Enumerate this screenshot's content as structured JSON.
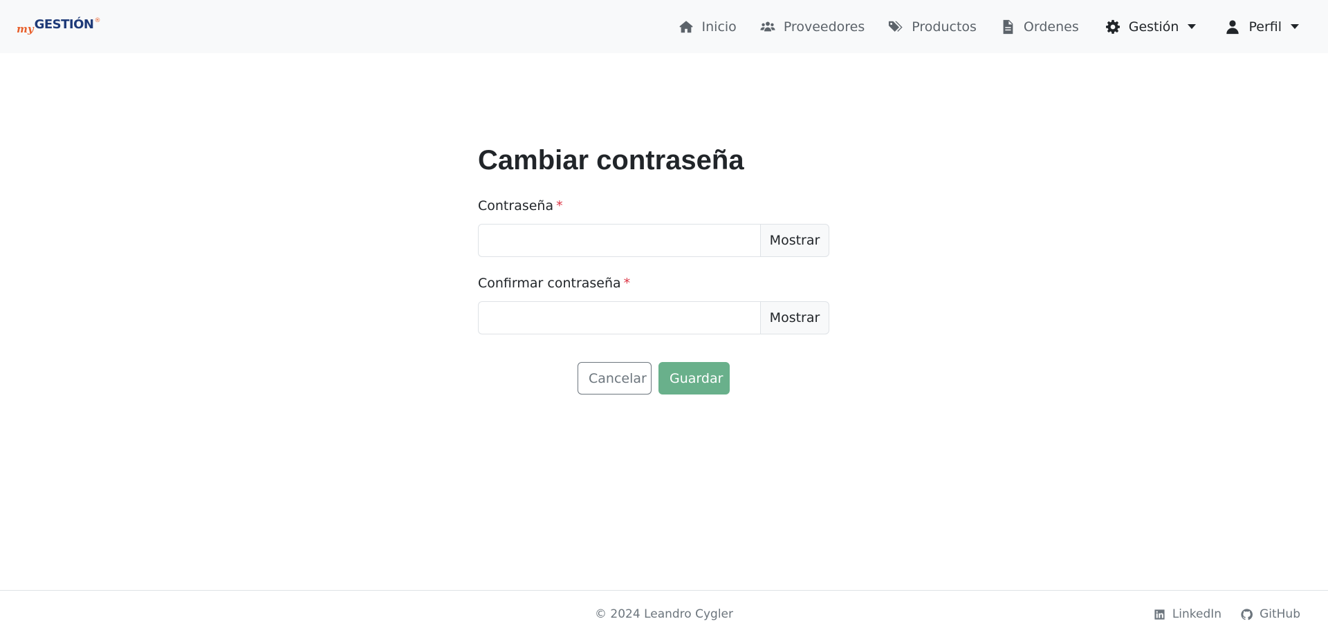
{
  "brand": {
    "prefix": "my",
    "name": "GESTIÓN",
    "mark": "®"
  },
  "nav": {
    "items": [
      {
        "label": "Inicio",
        "icon": "home-icon"
      },
      {
        "label": "Proveedores",
        "icon": "users-icon"
      },
      {
        "label": "Productos",
        "icon": "tags-icon"
      },
      {
        "label": "Ordenes",
        "icon": "file-icon"
      },
      {
        "label": "Gestión",
        "icon": "gear-icon"
      },
      {
        "label": "Perfil",
        "icon": "user-icon"
      }
    ]
  },
  "form": {
    "title": "Cambiar contraseña",
    "password_label": "Contraseña",
    "confirm_label": "Confirmar contraseña",
    "required_mark": "*",
    "password_value": "",
    "confirm_value": "",
    "show_label": "Mostrar",
    "cancel_label": "Cancelar",
    "save_label": "Guardar"
  },
  "footer": {
    "copyright": "© 2024 Leandro Cygler",
    "links": [
      {
        "label": "LinkedIn",
        "icon": "linkedin-icon"
      },
      {
        "label": "GitHub",
        "icon": "github-icon"
      }
    ]
  },
  "colors": {
    "navbar_bg": "#f8f9fa",
    "accent_save": "#69b08b",
    "required": "#dc3545",
    "brand_blue": "#1e3a78",
    "brand_orange": "#e8602c"
  }
}
